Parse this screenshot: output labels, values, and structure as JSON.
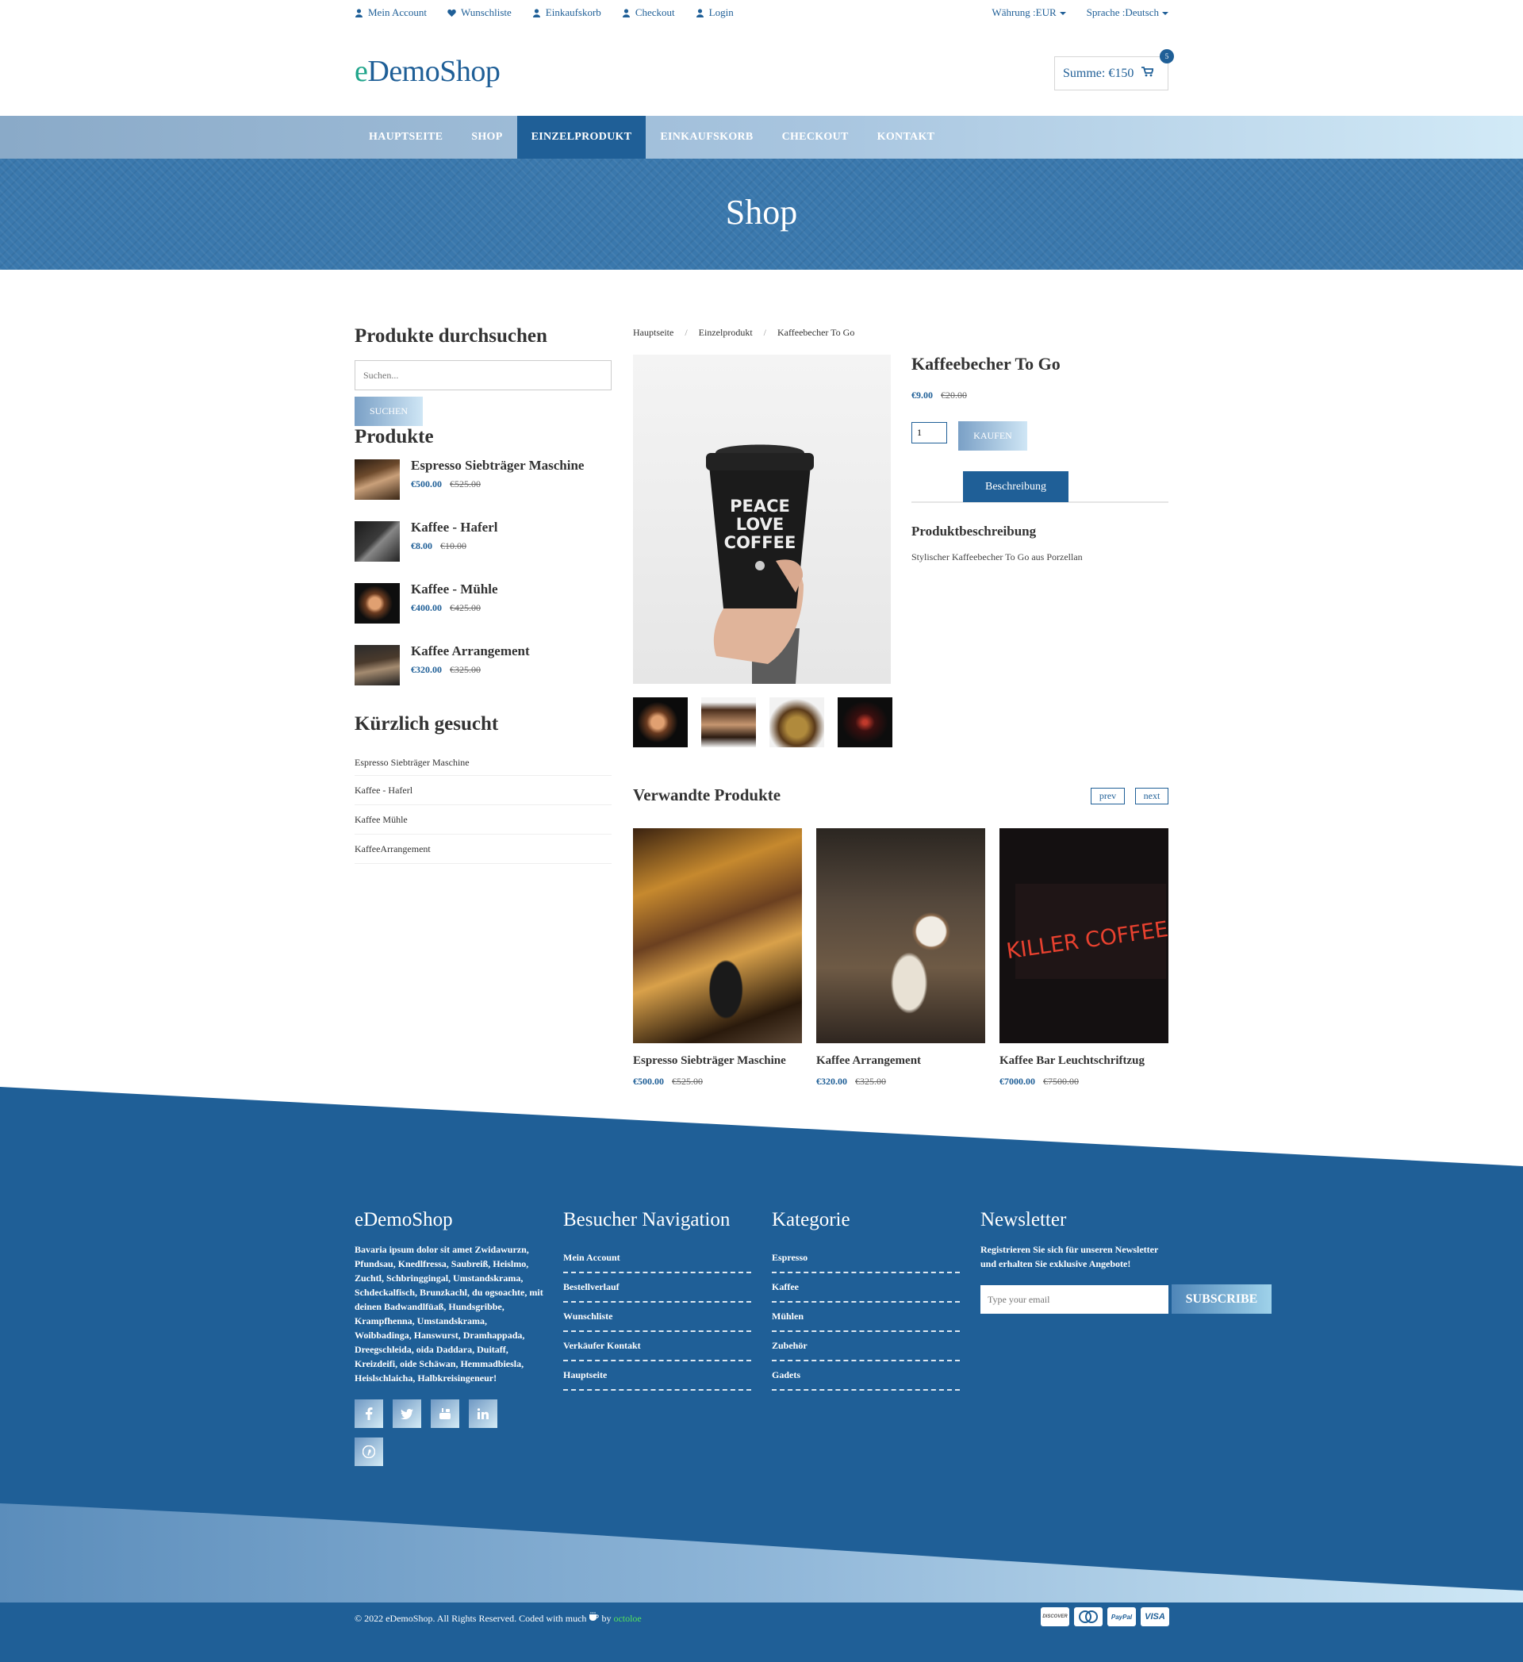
{
  "topbar": {
    "links": [
      {
        "label": "Mein Account",
        "icon": "user-icon"
      },
      {
        "label": "Wunschliste",
        "icon": "heart-icon"
      },
      {
        "label": "Einkaufskorb",
        "icon": "user-icon"
      },
      {
        "label": "Checkout",
        "icon": "user-icon"
      },
      {
        "label": "Login",
        "icon": "user-icon"
      }
    ],
    "currency": "Währung :EUR",
    "language": "Sprache :Deutsch"
  },
  "header": {
    "logo_prefix": "e",
    "logo_rest": "DemoShop",
    "cart_label": "Summe: €150",
    "cart_count": "5"
  },
  "nav": {
    "items": [
      "HAUPTSEITE",
      "SHOP",
      "EINZELPRODUKT",
      "EINKAUFSKORB",
      "CHECKOUT",
      "KONTAKT"
    ],
    "active": "EINZELPRODUKT"
  },
  "hero": {
    "title": "Shop"
  },
  "sidebar": {
    "search_title": "Produkte durchsuchen",
    "search_placeholder": "Suchen...",
    "search_button": "SUCHEN",
    "products_title": "Produkte",
    "products": [
      {
        "name": "Espresso Siebträger Maschine",
        "price": "€500.00",
        "old": "€525.00"
      },
      {
        "name": "Kaffee - Haferl",
        "price": "€8.00",
        "old": "€10.00"
      },
      {
        "name": "Kaffee - Mühle",
        "price": "€400.00",
        "old": "€425.00"
      },
      {
        "name": "Kaffee Arrangement",
        "price": "€320.00",
        "old": "€325.00"
      }
    ],
    "recent_title": "Kürzlich gesucht",
    "recent": [
      "Espresso Siebträger Maschine",
      "Kaffee - Haferl",
      "Kaffee Mühle",
      "KaffeeArrangement"
    ]
  },
  "breadcrumb": [
    "Hauptseite",
    "Einzelprodukt",
    "Kaffeebecher To Go"
  ],
  "product": {
    "name": "Kaffeebecher To Go",
    "price": "€9.00",
    "old": "€20.00",
    "qty": "1",
    "buy_label": "KAUFEN",
    "tab_label": "Beschreibung",
    "desc_title": "Produktbeschreibung",
    "desc_text": "Stylischer Kaffeebecher To Go aus Porzellan",
    "cup_text": [
      "PEACE",
      "LOVE",
      "COFFEE"
    ]
  },
  "related": {
    "title": "Verwandte Produkte",
    "prev": "prev",
    "next": "next",
    "items": [
      {
        "name": "Espresso Siebträger Maschine",
        "price": "€500.00",
        "old": "€525.00"
      },
      {
        "name": "Kaffee Arrangement",
        "price": "€320.00",
        "old": "€325.00"
      },
      {
        "name": "Kaffee Bar Leuchtschriftzug",
        "price": "€7000.00",
        "old": "€7500.00"
      }
    ],
    "neon_text": "KILLER COFFEE"
  },
  "footer": {
    "about_title": "eDemoShop",
    "about_text": "Bavaria ipsum dolor sit amet Zwidawurzn, Pfundsau, Knedlfressa, Saubreiß, Heislmo, Zuchtl, Schbringgingal, Umstandskrama, Schdeckalfisch, Brunzkachl, du ogsoachte, mit deinen Badwandlfüaß, Hundsgribbe, Krampfhenna, Umstandskrama, Woibbadinga, Hanswurst, Dramhappada, Dreegschleida, oida Daddara, Duitaff, Kreizdeifi, oide Schäwan, Hemmadbiesla, Heislschlaicha, Halbkreisingeneur!",
    "nav_title": "Besucher Navigation",
    "nav_links": [
      "Mein Account",
      "Bestellverlauf",
      "Wunschliste",
      "Verkäufer Kontakt",
      "Hauptseite"
    ],
    "cat_title": "Kategorie",
    "cat_links": [
      "Espresso",
      "Kaffee",
      "Mühlen",
      "Zubehör",
      "Gadets"
    ],
    "news_title": "Newsletter",
    "news_text": "Registrieren Sie sich für unseren Newsletter und erhalten Sie exklusive Angebote!",
    "email_placeholder": "Type your email",
    "subscribe": "SUBSCRIBE",
    "copyright_pre": "© 2022 eDemoShop. All Rights Reserved. Coded with much",
    "copyright_by": "by",
    "copyright_author": "octoloe",
    "cards": [
      "DISCOVER",
      "MasterCard",
      "PayPal",
      "VISA"
    ]
  },
  "colors": {
    "primary": "#1f5f97",
    "accent_logo": "#20a58b",
    "hero": "#3a78ad",
    "author": "#54e35c"
  }
}
